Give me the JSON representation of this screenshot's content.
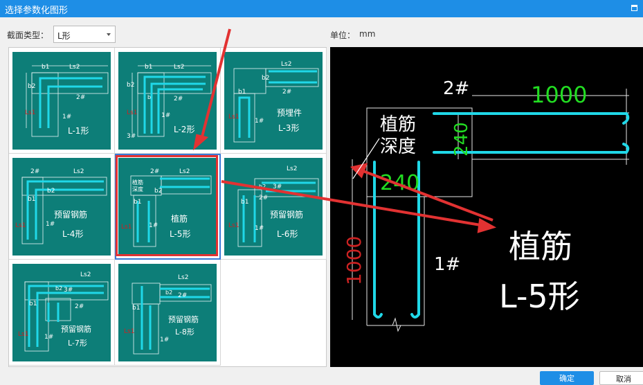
{
  "window": {
    "title": "选择参数化图形"
  },
  "section_type": {
    "label": "截面类型：",
    "value": "L形"
  },
  "unit": {
    "label": "单位：",
    "value": "mm"
  },
  "shapes": [
    {
      "id": "L-1",
      "name": "L-1形",
      "extra": "",
      "labels": [
        "b1",
        "Ls2",
        "b2",
        "2#",
        "1#",
        "Ls1"
      ]
    },
    {
      "id": "L-2",
      "name": "L-2形",
      "extra": "",
      "labels": [
        "b1",
        "Ls2",
        "b2",
        "2#",
        "1#",
        "3#",
        "Ls1",
        "b"
      ]
    },
    {
      "id": "L-3",
      "name": "L-3形",
      "extra": "预埋件",
      "labels": [
        "b1",
        "Ls2",
        "b2",
        "2#",
        "1#",
        "Ls1"
      ]
    },
    {
      "id": "L-4",
      "name": "L-4形",
      "extra": "预留钢筋",
      "labels": [
        "2#",
        "Ls2",
        "b2",
        "b1",
        "1#",
        "Ls1"
      ]
    },
    {
      "id": "L-5",
      "name": "L-5形",
      "extra": "植筋",
      "labels": [
        "2#",
        "Ls2",
        "b2",
        "b1",
        "1#",
        "Ls1",
        "植筋",
        "深度"
      ]
    },
    {
      "id": "L-6",
      "name": "L-6形",
      "extra": "预留钢筋",
      "labels": [
        "Ls2",
        "b2",
        "3#",
        "2#",
        "b1",
        "1#",
        "Ls1"
      ]
    },
    {
      "id": "L-7",
      "name": "L-7形",
      "extra": "预留钢筋",
      "labels": [
        "Ls2",
        "b2",
        "3#",
        "b1",
        "2#",
        "1#",
        "Ls1"
      ]
    },
    {
      "id": "L-8",
      "name": "L-8形",
      "extra": "预留钢筋",
      "labels": [
        "Ls2",
        "b2",
        "2#",
        "b1",
        "1#",
        "Ls1"
      ]
    }
  ],
  "preview": {
    "label_2": "2#",
    "dim_top": "1000",
    "dim_240_v": "240",
    "dim_240_h": "240",
    "label_1": "1#",
    "dim_left": "1000",
    "plant_line1": "植筋",
    "plant_line2": "深度",
    "big_line1": "植筋",
    "big_line2": "L-5形"
  },
  "buttons": {
    "ok": "确定",
    "cancel": "取消"
  },
  "colors": {
    "titlebar": "#1e8ee6",
    "thumb_bg": "#0d7e78",
    "rebar": "#20d8e8",
    "dim_green": "#22dd22",
    "dim_red": "#cc2222",
    "highlight": "#e23232"
  }
}
